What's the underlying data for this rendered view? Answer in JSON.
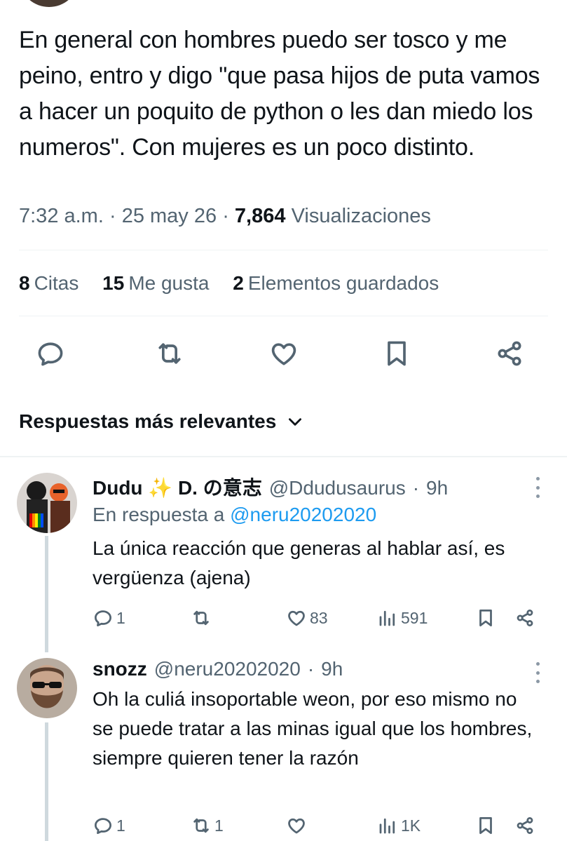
{
  "tweet": {
    "text": "En general con hombres puedo ser tosco y me peino, entro y digo \"que pasa hijos de puta vamos a hacer un poquito de python o les dan miedo los numeros\". Con mujeres es un poco distinto.",
    "time": "7:32 a.m.",
    "date": "25 may 26",
    "views_count": "7,864",
    "views_label": "Visualizaciones",
    "separator": "·"
  },
  "stats": [
    {
      "count": "8",
      "label": "Citas"
    },
    {
      "count": "15",
      "label": "Me gusta"
    },
    {
      "count": "2",
      "label": "Elementos guardados"
    }
  ],
  "actions": {
    "icons": [
      "reply-icon",
      "retweet-icon",
      "like-icon",
      "bookmark-icon",
      "share-icon"
    ]
  },
  "replies_sort": {
    "label": "Respuestas más relevantes"
  },
  "replies": [
    {
      "name": "Dudu ✨ D. の意志",
      "handle": "@Ddudusaurus",
      "time": "9h",
      "reply_to_prefix": "En respuesta a",
      "reply_to_handle": "@neru20202020",
      "text": "La única reacción que generas al hablar así, es vergüenza (ajena)",
      "reply_count": "1",
      "retweet_count": "",
      "like_count": "83",
      "view_count": "591"
    },
    {
      "name": "snozz",
      "handle": "@neru20202020",
      "time": "9h",
      "text": "Oh la culiá insoportable weon, por eso mismo no se puede tratar a las minas igual que los hombres, siempre quieren tener la razón",
      "reply_count": "1",
      "retweet_count": "1",
      "like_count": "",
      "view_count": "1K"
    }
  ],
  "colors": {
    "text": "#0f1419",
    "secondary": "#536471",
    "link": "#1d9bf0",
    "divider": "#eff3f4",
    "thread": "#cfd9de"
  }
}
